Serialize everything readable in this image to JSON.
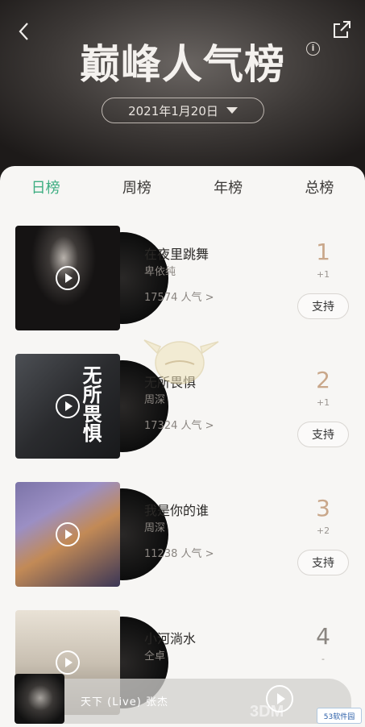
{
  "header": {
    "title": "巅峰人气榜",
    "info_glyph": "i",
    "date": "2021年1月20日"
  },
  "tabs": [
    {
      "label": "日榜",
      "active": true
    },
    {
      "label": "周榜",
      "active": false
    },
    {
      "label": "年榜",
      "active": false
    },
    {
      "label": "总榜",
      "active": false
    }
  ],
  "songs": [
    {
      "rank": "1",
      "change": "+1",
      "title": "在夜里跳舞",
      "artist": "卑依纯",
      "popularity": "17574 人气 >",
      "support": "支持"
    },
    {
      "rank": "2",
      "change": "+1",
      "title": "无所畏惧",
      "artist": "周深",
      "popularity": "17324 人气 >",
      "support": "支持",
      "cover_text": "无所畏惧"
    },
    {
      "rank": "3",
      "change": "+2",
      "title": "我是你的谁",
      "artist": "周深",
      "popularity": "11238 人气 >",
      "support": "支持"
    },
    {
      "rank": "4",
      "change": "-",
      "title": "小河淌水",
      "artist": "仝卓",
      "popularity": "",
      "support": ""
    }
  ],
  "player": {
    "now_playing": "天下  (Live)  张杰"
  },
  "watermark": {
    "brand": "3DM",
    "badge": "53软件园"
  },
  "colors": {
    "accent": "#3fae82",
    "rank": "#c9a78a"
  }
}
